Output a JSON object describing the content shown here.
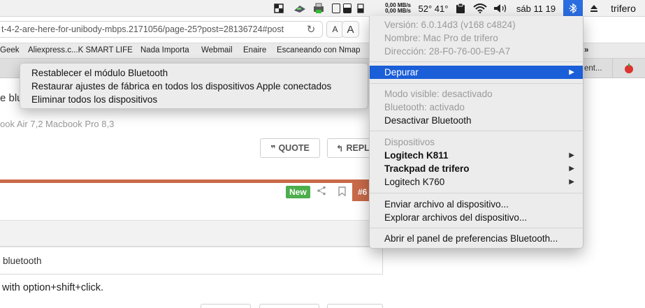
{
  "menubar": {
    "net_up": "0,00 MB/s",
    "net_down": "0,00 MB/s",
    "temp": "52° 41°",
    "clock": "sáb 11 19",
    "user": "trifero",
    "icons": [
      "window-icon",
      "drive-icon",
      "printer-icon",
      "cpu-icon",
      "memory-icon",
      "clipboard-icon",
      "wifi-icon",
      "volume-icon",
      "bluetooth-icon",
      "eject-icon"
    ]
  },
  "browser": {
    "url": "t-4-2-are-here-for-unibody-mbps.2171056/page-25?post=28136724#post",
    "font_small": "A",
    "font_large": "A",
    "bookmarks": [
      "Geek",
      "Aliexpress.c...K SMART LIFE",
      "Nada Importa",
      "Webmail",
      "Enaire",
      "Escaneando con Nmap"
    ],
    "tab_fragment": "ent...",
    "bookmarks_overflow": "»"
  },
  "page": {
    "frag_bluetooth": "e blu",
    "frag_models": "ook Air 7,2 Macbook Pro 8,3",
    "quote_label": "QUOTE",
    "reply_label": "REPL",
    "new_badge": "New",
    "post_number": "#6",
    "quote_text": "bluetooth",
    "body_text": "with option+shift+click."
  },
  "submenu": {
    "items": [
      "Restablecer el módulo Bluetooth",
      "Restaurar ajustes de fábrica en todos los dispositivos Apple conectados",
      "Eliminar todos los dispositivos"
    ]
  },
  "bluetooth_menu": {
    "version": "Versión: 6.0.14d3 (v168 c4824)",
    "name": "Nombre: Mac Pro de trifero",
    "address": "Dirección: 28-F0-76-00-E9-A7",
    "debug": "Depurar",
    "visible_mode": "Modo visible: desactivado",
    "bt_status": "Bluetooth: activado",
    "disable": "Desactivar Bluetooth",
    "devices_header": "Dispositivos",
    "devices": [
      "Logitech K811",
      "Trackpad de trifero",
      "Logitech K760"
    ],
    "send_file": "Enviar archivo al dispositivo...",
    "browse_files": "Explorar archivos del dispositivo...",
    "open_prefs": "Abrir el panel de preferencias Bluetooth...",
    "submenu_arrow": "▶"
  },
  "colors": {
    "highlight": "#1a5ed8",
    "bt_icon_bg": "#2a6de0",
    "new_badge": "#4cae4c",
    "post_accent": "#c96a4a"
  }
}
